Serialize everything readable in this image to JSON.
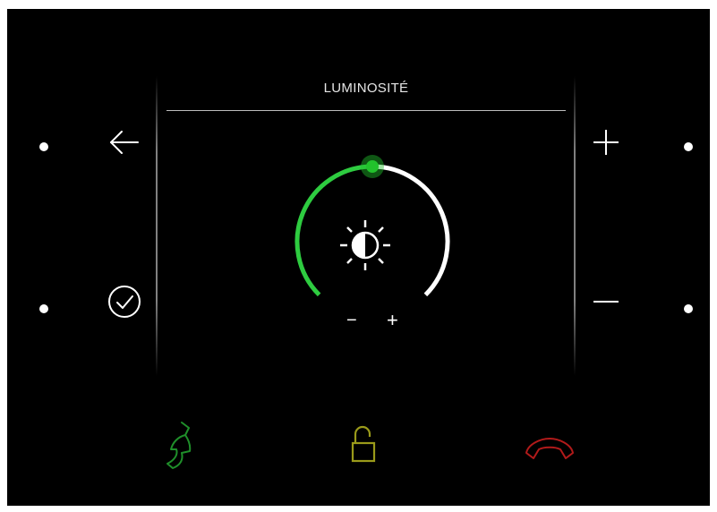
{
  "screen": {
    "title": "LUMINOSITÉ"
  },
  "left_keys": {
    "top_icon": "arrow-left-icon",
    "bottom_icon": "check-circle-icon"
  },
  "right_keys": {
    "top_icon": "plus-icon",
    "bottom_icon": "minus-icon"
  },
  "brightness_dial": {
    "icon": "brightness-icon",
    "level": 0.5,
    "minus_label": "−",
    "plus_label": "+",
    "colors": {
      "fill": "#2ecc40",
      "track": "#ffffff",
      "knob": "#22c22c"
    }
  },
  "bottom_bar": {
    "call_icon": "phone-answer-icon",
    "unlock_icon": "unlock-icon",
    "hangup_icon": "phone-hangup-icon",
    "colors": {
      "call": "#1f8f2a",
      "unlock": "#9a9a1a",
      "hangup": "#b11a1a"
    }
  }
}
